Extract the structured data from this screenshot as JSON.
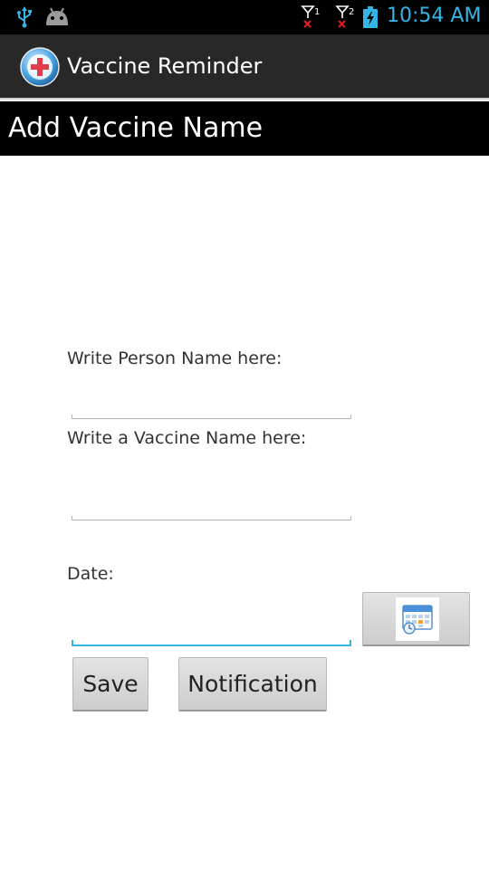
{
  "status_bar": {
    "time": "10:54 AM",
    "icons": [
      "usb-icon",
      "android-debug-icon",
      "signal-sim1-icon",
      "signal-sim2-icon",
      "battery-charging-icon"
    ],
    "sim1_label": "1",
    "sim2_label": "2",
    "accent_color": "#33b5e5"
  },
  "action_bar": {
    "app_title": "Vaccine Reminder",
    "app_icon": "vaccine-app-icon"
  },
  "page_header": {
    "title": "Add Vaccine Name"
  },
  "form": {
    "person_label": "Write Person Name here:",
    "person_value": "",
    "vaccine_label": "Write a Vaccine Name here:",
    "vaccine_value": "",
    "date_label": "Date:",
    "date_value": "",
    "calendar_button_icon": "calendar-icon",
    "save_label": "Save",
    "notification_label": "Notification"
  }
}
